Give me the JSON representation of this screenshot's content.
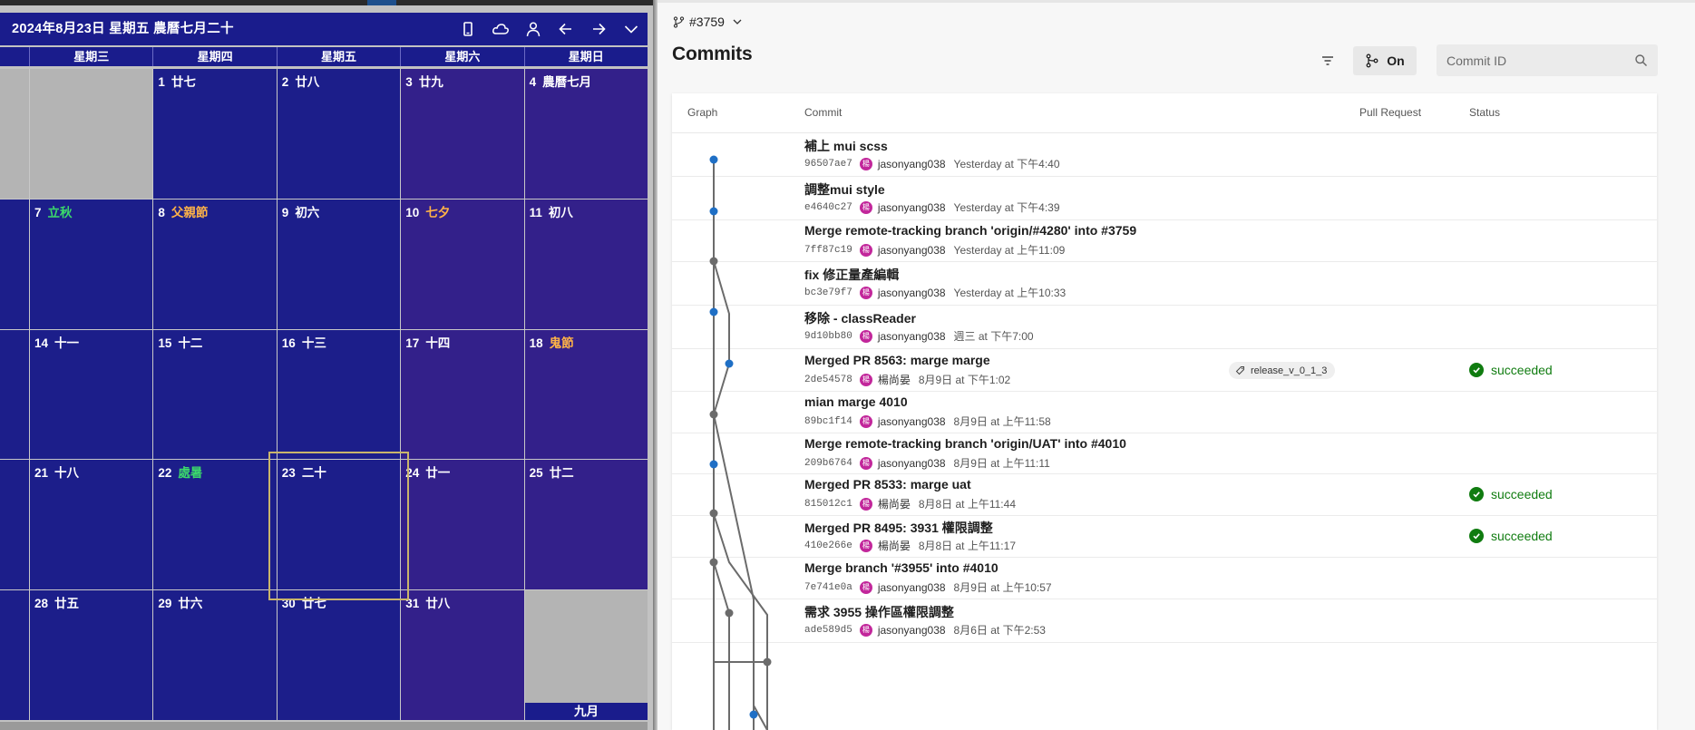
{
  "calendar": {
    "title": "2024年8月23日 星期五 農曆七月二十",
    "weekdays": [
      "星期三",
      "星期四",
      "星期五",
      "星期六",
      "星期日"
    ],
    "rows": [
      [
        {
          "d": ""
        },
        {
          "d": "1",
          "l": "廿七"
        },
        {
          "d": "2",
          "l": "廿八"
        },
        {
          "d": "3",
          "l": "廿九"
        },
        {
          "d": "4",
          "l": "農曆七月"
        }
      ],
      [
        {
          "d": "7",
          "l": "立秋",
          "k": "term"
        },
        {
          "d": "8",
          "l": "父親節",
          "k": "hol"
        },
        {
          "d": "9",
          "l": "初六"
        },
        {
          "d": "10",
          "l": "七夕",
          "k": "hol"
        },
        {
          "d": "11",
          "l": "初八"
        }
      ],
      [
        {
          "d": "14",
          "l": "十一"
        },
        {
          "d": "15",
          "l": "十二"
        },
        {
          "d": "16",
          "l": "十三"
        },
        {
          "d": "17",
          "l": "十四"
        },
        {
          "d": "18",
          "l": "鬼節",
          "k": "hol"
        }
      ],
      [
        {
          "d": "21",
          "l": "十八"
        },
        {
          "d": "22",
          "l": "處暑",
          "k": "term"
        },
        {
          "d": "23",
          "l": "二十"
        },
        {
          "d": "24",
          "l": "廿一"
        },
        {
          "d": "25",
          "l": "廿二"
        }
      ],
      [
        {
          "d": "28",
          "l": "廿五"
        },
        {
          "d": "29",
          "l": "廿六"
        },
        {
          "d": "30",
          "l": "廿七"
        },
        {
          "d": "31",
          "l": "廿八"
        },
        {
          "d": ""
        }
      ]
    ],
    "next_month": "九月",
    "tool_icons": [
      "phone-icon",
      "cloud-icon",
      "person-icon",
      "arrow-left-icon",
      "arrow-right-icon",
      "chevron-down-icon"
    ]
  },
  "devops": {
    "branch": "#3759",
    "title": "Commits",
    "graph_toggle": "On",
    "search_placeholder": "Commit ID",
    "columns": {
      "graph": "Graph",
      "commit": "Commit",
      "pull_request": "Pull Request",
      "status": "Status"
    },
    "colors": {
      "node_blue": "#1f6fc5",
      "node_gray": "#6b6b6b",
      "success": "#107c10",
      "avatar": "#c2279b"
    },
    "commits": [
      {
        "msg": "補上 mui scss",
        "sha": "96507ae7",
        "avatar": "楊",
        "author": "jasonyang038",
        "time": "Yesterday at 下午4:40",
        "tag": "",
        "status": ""
      },
      {
        "msg": "調整mui style",
        "sha": "e4640c27",
        "avatar": "楊",
        "author": "jasonyang038",
        "time": "Yesterday at 下午4:39",
        "tag": "",
        "status": ""
      },
      {
        "msg": "Merge remote-tracking branch 'origin/#4280' into #3759",
        "sha": "7ff87c19",
        "avatar": "楊",
        "author": "jasonyang038",
        "time": "Yesterday at 上午11:09",
        "tag": "",
        "status": ""
      },
      {
        "msg": "fix 修正量產編輯",
        "sha": "bc3e79f7",
        "avatar": "楊",
        "author": "jasonyang038",
        "time": "Yesterday at 上午10:33",
        "tag": "",
        "status": ""
      },
      {
        "msg": "移除 - classReader",
        "sha": "9d10bb80",
        "avatar": "楊",
        "author": "jasonyang038",
        "time": "週三 at 下午7:00",
        "tag": "",
        "status": ""
      },
      {
        "msg": "Merged PR 8563: marge marge",
        "sha": "2de54578",
        "avatar": "楊",
        "author": "楊尚晏",
        "time": "8月9日 at 下午1:02",
        "tag": "release_v_0_1_3",
        "status": "succeeded"
      },
      {
        "msg": "mian marge 4010",
        "sha": "89bc1f14",
        "avatar": "楊",
        "author": "jasonyang038",
        "time": "8月9日 at 上午11:58",
        "tag": "",
        "status": ""
      },
      {
        "msg": "Merge remote-tracking branch 'origin/UAT' into #4010",
        "sha": "209b6764",
        "avatar": "楊",
        "author": "jasonyang038",
        "time": "8月9日 at 上午11:11",
        "tag": "",
        "status": ""
      },
      {
        "msg": "Merged PR 8533: marge uat",
        "sha": "815012c1",
        "avatar": "楊",
        "author": "楊尚晏",
        "time": "8月8日 at 上午11:44",
        "tag": "",
        "status": "succeeded"
      },
      {
        "msg": "Merged PR 8495: 3931 權限調整",
        "sha": "410e266e",
        "avatar": "楊",
        "author": "楊尚晏",
        "time": "8月8日 at 上午11:17",
        "tag": "",
        "status": "succeeded"
      },
      {
        "msg": "Merge branch '#3955' into #4010",
        "sha": "7e741e0a",
        "avatar": "楊",
        "author": "jasonyang038",
        "time": "8月9日 at 上午10:57",
        "tag": "",
        "status": ""
      },
      {
        "msg": "需求 3955 操作區權限調整",
        "sha": "ade589d5",
        "avatar": "楊",
        "author": "jasonyang038",
        "time": "8月6日 at 下午2:53",
        "tag": "",
        "status": ""
      }
    ]
  }
}
